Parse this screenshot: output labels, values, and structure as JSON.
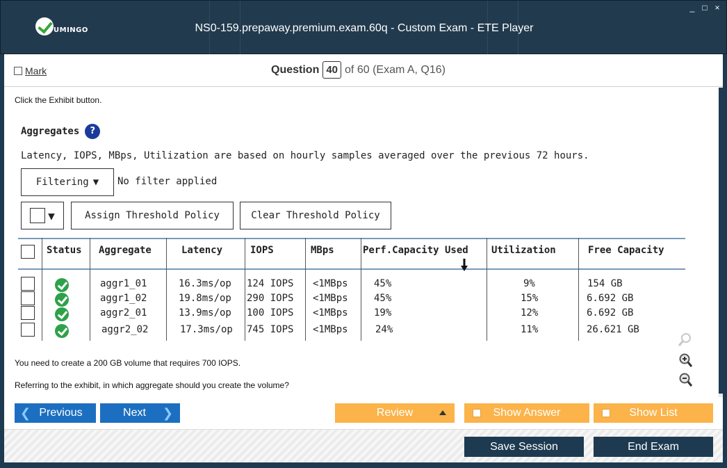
{
  "window": {
    "title": "NS0-159.prepaway.premium.exam.60q - Custom Exam - ETE Player",
    "logo_text": "UMINGO",
    "controls": [
      "_",
      "□",
      "×"
    ]
  },
  "header": {
    "mark_label": "Mark",
    "question_label": "Question",
    "question_number": "40",
    "question_rest": "of 60 (Exam A, Q16)"
  },
  "content": {
    "instruction": "Click the Exhibit button.",
    "exhibit": {
      "title": "Aggregates",
      "help_icon": "?",
      "description": "Latency, IOPS, MBps, Utilization are based on hourly samples averaged over the previous 72 hours.",
      "filter_button": "Filtering",
      "filter_status": "No filter applied",
      "assign_button": "Assign Threshold Policy",
      "clear_button": "Clear Threshold Policy",
      "table": {
        "headers": [
          "Status",
          "Aggregate",
          "Latency",
          "IOPS",
          "MBps",
          "Perf.Capacity Used",
          "Utilization",
          "Free Capacity"
        ],
        "rows": [
          {
            "aggregate": "aggr1_01",
            "latency": "16.3ms/op",
            "iops": "124 IOPS",
            "mbps": "<1MBps",
            "perf": "45%",
            "util": "9%",
            "free": "154 GB"
          },
          {
            "aggregate": "aggr1_02",
            "latency": "19.8ms/op",
            "iops": "290 IOPS",
            "mbps": "<1MBps",
            "perf": "45%",
            "util": "15%",
            "free": "6.692 GB"
          },
          {
            "aggregate": "aggr2_01",
            "latency": "13.9ms/op",
            "iops": "100 IOPS",
            "mbps": "<1MBps",
            "perf": "19%",
            "util": "12%",
            "free": "6.692 GB"
          },
          {
            "aggregate": "aggr2_02",
            "latency": "17.3ms/op",
            "iops": "745 IOPS",
            "mbps": "<1MBps",
            "perf": "24%",
            "util": "11%",
            "free": "26.621 GB"
          }
        ]
      }
    },
    "question_line1": "You need to create a 200 GB volume that requires 700 IOPS.",
    "question_line2": "Referring to the exhibit, in which aggregate should you create the volume?"
  },
  "navigation": {
    "previous": "Previous",
    "next": "Next",
    "review": "Review",
    "show_answer": "Show Answer",
    "show_list": "Show List"
  },
  "session": {
    "save": "Save Session",
    "end": "End Exam"
  },
  "colors": {
    "titlebar": "#223a4e",
    "nav_blue": "#1c6fc0",
    "orange": "#fbb34a",
    "dark_button": "#1d3a50",
    "status_ok": "#2ea14a"
  }
}
